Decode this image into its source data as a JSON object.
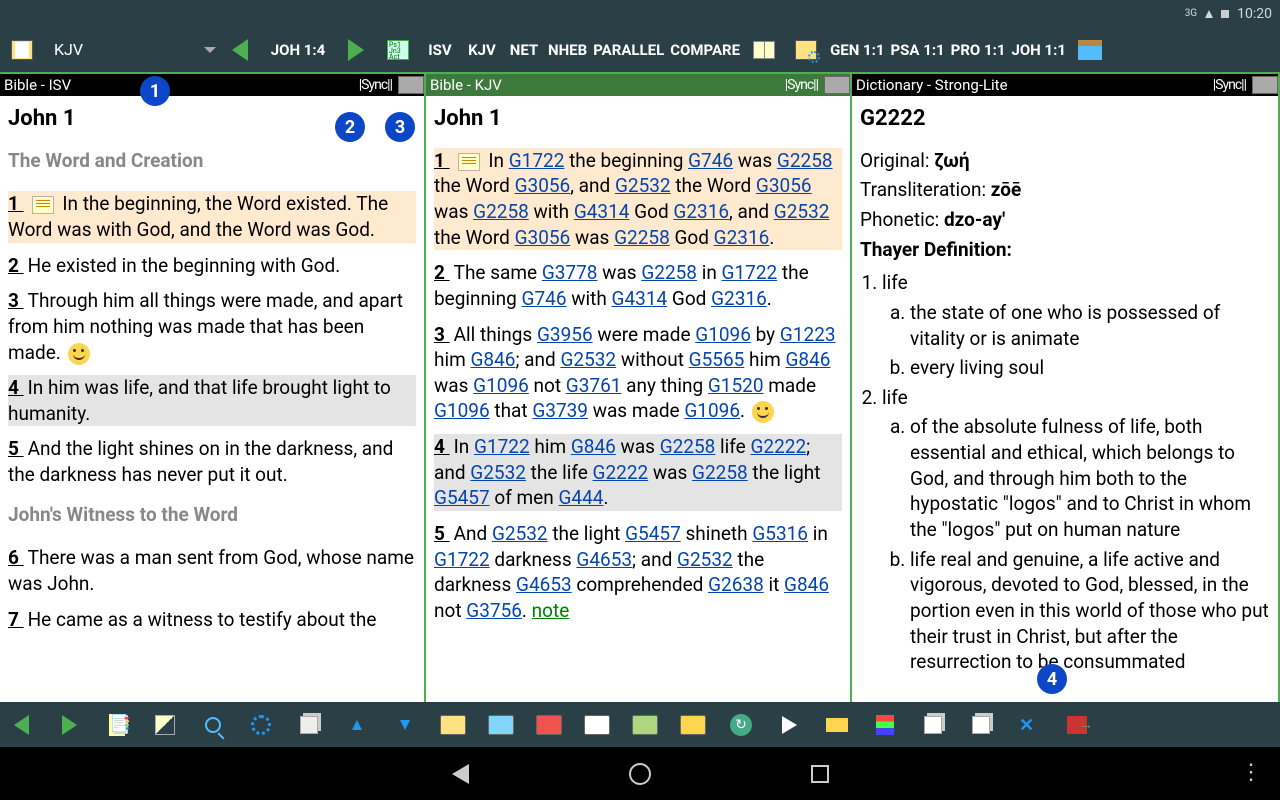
{
  "status": {
    "net": "3G",
    "time": "10:20",
    "bat": "▮"
  },
  "topbar": {
    "version": "KJV",
    "verse": "JOH 1:4",
    "views": [
      "ISV",
      "KJV",
      "NET",
      "NHEB",
      "PARALLEL",
      "COMPARE"
    ],
    "shortcuts": [
      "GEN 1:1",
      "PSA 1:1",
      "PRO 1:1",
      "JOH 1:1"
    ]
  },
  "paneA": {
    "title": "Bible - ISV",
    "sync": "|Sync||",
    "chapter": "John 1",
    "sec1": "The Word and Creation",
    "v1": " In the beginning, the Word existed. The Word was with God, and the Word was God.",
    "v2": " He existed in the beginning with God.",
    "v3": " Through him all things were made, and apart from him nothing was made that has been made.  ",
    "v4": " In him was life, and that life brought light to humanity.",
    "v5": " And the light shines on in the darkness, and the darkness has never put it out.",
    "sec2": "John's Witness to the Word",
    "v6": " There was a man sent from God, whose name was John.",
    "v7": " He came as a witness to testify about the"
  },
  "paneB": {
    "title": "Bible - KJV",
    "sync": "|Sync||",
    "chapter": "John 1"
  },
  "paneC": {
    "title": "Dictionary - Strong-Lite",
    "sync": "|Sync||",
    "code": "G2222",
    "orig_l": "Original: ",
    "orig": "ζωή",
    "tr_l": "Transliteration: ",
    "tr": "zōē",
    "ph_l": "Phonetic: ",
    "ph": "dzo-ay'",
    "def_h": "Thayer Definition:",
    "d1": "life",
    "d1a": "the state of one who is possessed of vitality or is animate",
    "d1b": "every living soul",
    "d2": "life",
    "d2a": "of the absolute fulness of life, both essential and ethical, which belongs to God, and through him both to the hypostatic \"logos\" and to Christ in whom the \"logos\" put on human nature",
    "d2b": "life real and genuine, a life active and vigorous, devoted to God, blessed, in the portion even in this world of those who put their trust in Christ, but after the resurrection to be consummated"
  },
  "markers": {
    "m1": "1",
    "m2": "2",
    "m3": "3",
    "m4": "4"
  }
}
